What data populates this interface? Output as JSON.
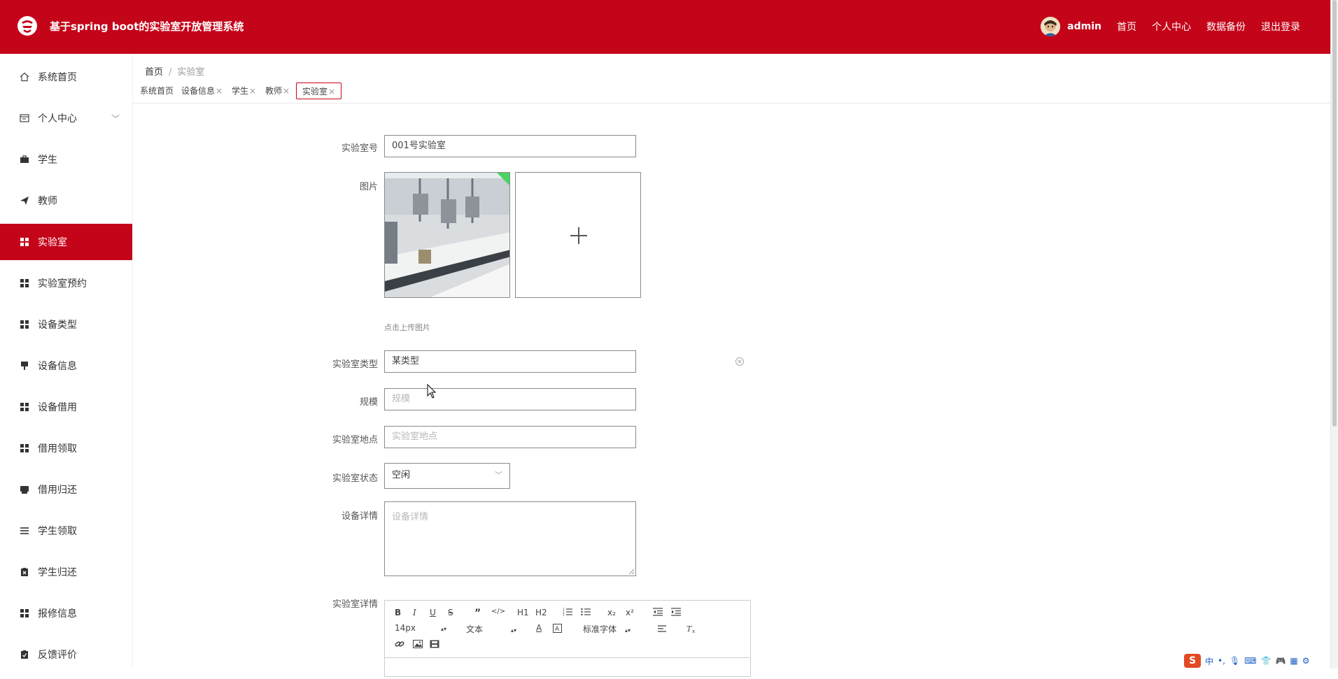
{
  "header": {
    "app_title": "基于spring boot的实验室开放管理系统",
    "user": "admin",
    "nav": [
      "首页",
      "个人中心",
      "数据备份",
      "退出登录"
    ]
  },
  "sidebar": {
    "items": [
      {
        "label": "系统首页",
        "icon": "home-icon"
      },
      {
        "label": "个人中心",
        "icon": "profile-card-icon",
        "has_submenu": true
      },
      {
        "label": "学生",
        "icon": "briefcase-icon"
      },
      {
        "label": "教师",
        "icon": "paper-plane-icon"
      },
      {
        "label": "实验室",
        "icon": "grid-icon",
        "active": true
      },
      {
        "label": "实验室预约",
        "icon": "grid-icon"
      },
      {
        "label": "设备类型",
        "icon": "grid-icon"
      },
      {
        "label": "设备信息",
        "icon": "stamp-icon"
      },
      {
        "label": "设备借用",
        "icon": "grid-icon"
      },
      {
        "label": "借用领取",
        "icon": "grid-icon"
      },
      {
        "label": "借用归还",
        "icon": "printer-icon"
      },
      {
        "label": "学生领取",
        "icon": "list-icon"
      },
      {
        "label": "学生归还",
        "icon": "clipboard-x-icon"
      },
      {
        "label": "报修信息",
        "icon": "grid-icon"
      },
      {
        "label": "反馈评价",
        "icon": "clipboard-check-icon"
      }
    ]
  },
  "breadcrumb": {
    "home": "首页",
    "separator": "/",
    "current": "实验室"
  },
  "tags": [
    {
      "label": "系统首页",
      "closable": false
    },
    {
      "label": "设备信息",
      "closable": true
    },
    {
      "label": "学生",
      "closable": true
    },
    {
      "label": "教师",
      "closable": true
    },
    {
      "label": "实验室",
      "closable": true,
      "active": true
    }
  ],
  "tag_close_glyph": "×",
  "form": {
    "lab_no_label": "实验室号",
    "lab_no_value": "001号实验室",
    "image_label": "图片",
    "image_hint": "点击上传图片",
    "lab_type_label": "实验室类型",
    "lab_type_value": "某类型",
    "scale_label": "规模",
    "scale_placeholder": "规模",
    "location_label": "实验室地点",
    "location_placeholder": "实验室地点",
    "status_label": "实验室状态",
    "status_value": "空闲",
    "equipment_label": "设备详情",
    "equipment_placeholder": "设备详情",
    "detail_label": "实验室详情"
  },
  "editor": {
    "font_size": "14px",
    "header_select": "文本",
    "font_family": "标准字体",
    "buttons": [
      "B",
      "I",
      "U",
      "S",
      "”",
      "</>",
      "H1",
      "H2",
      "x₂",
      "x²"
    ]
  },
  "ime": {
    "label": "中"
  },
  "colors": {
    "brand": "#c40419",
    "sidebar_active": "#c40419"
  }
}
